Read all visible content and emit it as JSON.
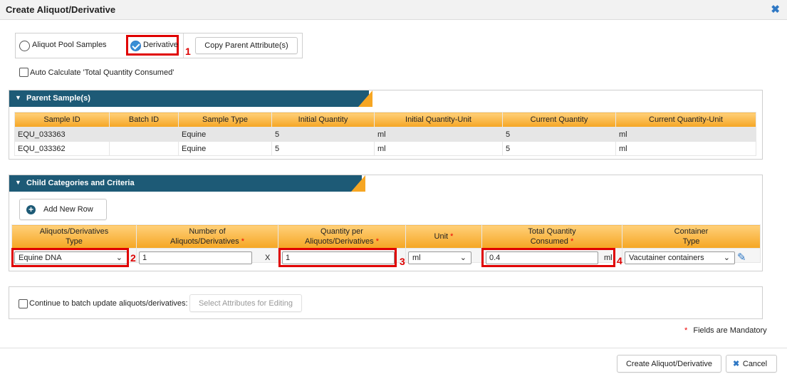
{
  "dialog": {
    "title": "Create Aliquot/Derivative",
    "close_icon": "close-icon"
  },
  "mode": {
    "option_pool": "Aliquot Pool Samples",
    "option_derivative": "Derivative",
    "selected": "Derivative",
    "copy_button": "Copy Parent Attribute(s)",
    "marker": "1"
  },
  "auto_calc": {
    "label": "Auto Calculate 'Total Quantity Consumed'",
    "checked": false
  },
  "parent_panel": {
    "title": "Parent Sample(s)",
    "columns": [
      "Sample ID",
      "Batch ID",
      "Sample Type",
      "Initial Quantity",
      "Initial Quantity-Unit",
      "Current Quantity",
      "Current Quantity-Unit"
    ],
    "rows": [
      [
        "EQU_033363",
        "",
        "Equine",
        "5",
        "ml",
        "5",
        "ml"
      ],
      [
        "EQU_033362",
        "",
        "Equine",
        "5",
        "ml",
        "5",
        "ml"
      ]
    ]
  },
  "child_panel": {
    "title": "Child Categories and Criteria",
    "add_row_button": "Add New Row",
    "columns": {
      "type": [
        "Aliquots/Derivatives",
        "Type"
      ],
      "number": [
        "Number of",
        "Aliquots/Derivatives"
      ],
      "qty_per": [
        "Quantity per",
        "Aliquots/Derivatives"
      ],
      "unit": "Unit",
      "total": [
        "Total Quantity",
        "Consumed"
      ],
      "container": [
        "Container",
        "Type"
      ]
    },
    "required_mark": "*",
    "row": {
      "type_value": "Equine DNA",
      "number_value": "1",
      "multiply": "X",
      "qty_per_value": "1",
      "unit_value": "ml",
      "total_value": "0.4",
      "total_unit": "ml",
      "container_value": "Vacutainer containers"
    },
    "markers": {
      "type": "2",
      "qty_per": "3",
      "total": "4"
    }
  },
  "batch": {
    "label": "Continue to batch update aliquots/derivatives:",
    "select_button": "Select Attributes for Editing"
  },
  "mandatory_note": "Fields are Mandatory",
  "footer": {
    "create_button": "Create Aliquot/Derivative",
    "cancel_button": "Cancel"
  },
  "colors": {
    "header_blue": "#1d5a76",
    "accent_orange": "#f6a623",
    "highlight_red": "#e00000",
    "link_blue": "#2f78c4"
  }
}
